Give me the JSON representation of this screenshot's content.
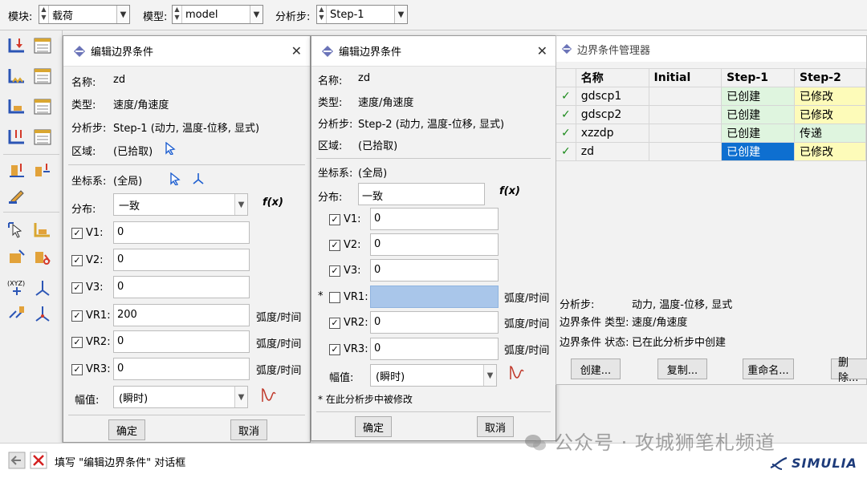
{
  "toolbar": {
    "module_label": "模块:",
    "module_value": "载荷",
    "model_label": "模型:",
    "model_value": "model",
    "step_label": "分析步:",
    "step_value": "Step-1"
  },
  "dialog1": {
    "title": "编辑边界条件",
    "name_label": "名称:",
    "name_value": "zd",
    "type_label": "类型:",
    "type_value": "速度/角速度",
    "step_label": "分析步:",
    "step_value": "Step-1 (动力, 温度-位移, 显式)",
    "region_label": "区域:",
    "region_value": "(已拾取)",
    "csys_label": "坐标系:",
    "csys_value": "(全局)",
    "dist_label": "分布:",
    "dist_value": "一致",
    "fx": "f(x)",
    "v1_label": "V1:",
    "v1_value": "0",
    "v2_label": "V2:",
    "v2_value": "0",
    "v3_label": "V3:",
    "v3_value": "0",
    "vr1_label": "VR1:",
    "vr1_value": "200",
    "vr2_label": "VR2:",
    "vr2_value": "0",
    "vr3_label": "VR3:",
    "vr3_value": "0",
    "unit": "弧度/时间",
    "amp_label": "幅值:",
    "amp_value": "(瞬时)",
    "ok": "确定",
    "cancel": "取消"
  },
  "dialog2": {
    "title": "编辑边界条件",
    "name_label": "名称:",
    "name_value": "zd",
    "type_label": "类型:",
    "type_value": "速度/角速度",
    "step_label": "分析步:",
    "step_value": "Step-2 (动力, 温度-位移, 显式)",
    "region_label": "区域:",
    "region_value": "(已拾取)",
    "csys_label": "坐标系:",
    "csys_value": "(全局)",
    "dist_label": "分布:",
    "dist_value": "一致",
    "fx": "f(x)",
    "v1_label": "V1:",
    "v1_value": "0",
    "v2_label": "V2:",
    "v2_value": "0",
    "v3_label": "V3:",
    "v3_value": "0",
    "vr1_mark": "*",
    "vr1_label": "VR1:",
    "vr1_value": "",
    "vr2_label": "VR2:",
    "vr2_value": "0",
    "vr3_label": "VR3:",
    "vr3_value": "0",
    "unit": "弧度/时间",
    "amp_label": "幅值:",
    "amp_value": "(瞬时)",
    "note": "* 在此分析步中被修改",
    "ok": "确定",
    "cancel": "取消"
  },
  "manager": {
    "title": "边界条件管理器",
    "columns": [
      "名称",
      "Initial",
      "Step-1",
      "Step-2"
    ],
    "rows": [
      {
        "name": "gdscp1",
        "initial": "",
        "step1": "已创建",
        "step2": "已修改"
      },
      {
        "name": "gdscp2",
        "initial": "",
        "step1": "已创建",
        "step2": "已修改"
      },
      {
        "name": "xzzdp",
        "initial": "",
        "step1": "已创建",
        "step2": "传递"
      },
      {
        "name": "zd",
        "initial": "",
        "step1": "已创建",
        "step2": "已修改"
      }
    ],
    "info_step_label": "分析步:",
    "info_step_value": "动力, 温度-位移, 显式",
    "info_type_label": "边界条件 类型:",
    "info_type_value": "速度/角速度",
    "info_status_label": "边界条件 状态:",
    "info_status_value": "已在此分析步中创建",
    "btn_create": "创建...",
    "btn_copy": "复制...",
    "btn_rename": "重命名...",
    "btn_delete": "删除..."
  },
  "status": {
    "prompt": "填写 \"编辑边界条件\" 对话框"
  },
  "watermark": "公众号 · 攻城狮笔札频道",
  "brand": "SIMULIA",
  "colors": {
    "selection_blue": "#0e6fd0",
    "created_green": "#dff5df",
    "modified_yellow": "#fdfbb9",
    "field_selected": "#a9c6ea"
  }
}
